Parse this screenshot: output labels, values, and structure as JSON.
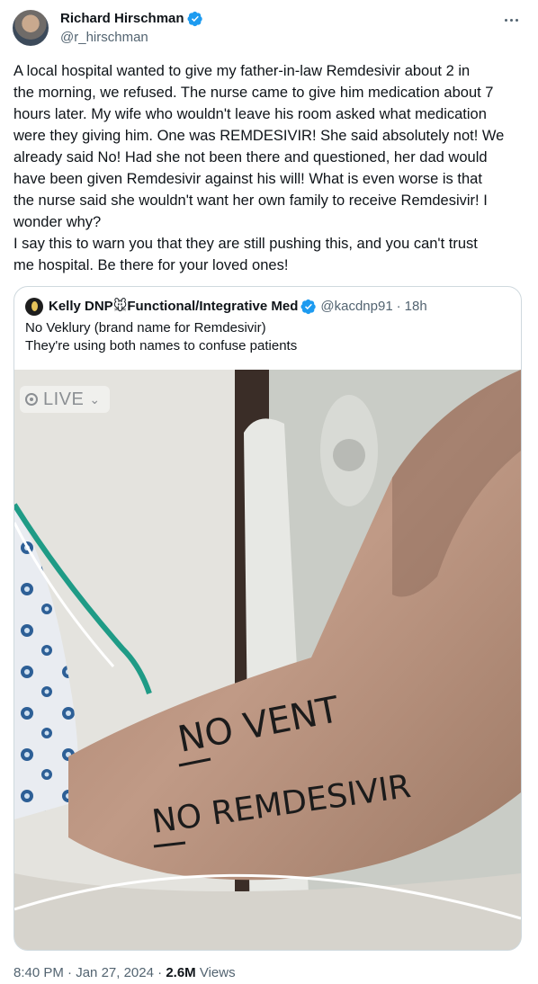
{
  "author": {
    "name": "Richard Hirschman",
    "handle": "@r_hirschman",
    "verified": true
  },
  "tweet": {
    "text": "A local hospital wanted to give my father-in-law Remdesivir about 2 in\nthe morning, we refused. The nurse came to give him medication about 7\nhours later. My wife who wouldn't leave his room asked what medication\nwere they giving him. One was REMDESIVIR! She said absolutely not! We\nalready said No! Had she not been there and questioned, her dad would\nhave been given Remdesivir against his will! What is even worse is that\nthe nurse said she wouldn't want her own family to receive Remdesivir! I\nwonder why?\nI say this to warn you that they are still pushing this, and you can't trust\nme hospital. Be there for your loved ones!"
  },
  "quoted": {
    "name": "Kelly DNP",
    "name_emoji": "🐭",
    "name_suffix": "Functional/Integrative Med",
    "handle": "@kacdnp91",
    "separator": "·",
    "time": "18h",
    "text": "No Veklury (brand name for Remdesivir)\nThey're using both names to confuse patients",
    "image": {
      "live_label": "LIVE",
      "handwriting_line1": "NO VENT",
      "handwriting_line2": "NO REMDESIVIR"
    }
  },
  "meta": {
    "time": "8:40 PM",
    "date": "Jan 27, 2024",
    "separator": "·",
    "views_count": "2.6M",
    "views_label": "Views"
  },
  "colors": {
    "verified_blue": "#1d9bf0",
    "secondary_text": "#536471",
    "border": "#cfd9de"
  },
  "icons": {
    "verified": "verified-badge-icon",
    "more": "more-dots-icon",
    "live": "live-broadcast-icon"
  }
}
